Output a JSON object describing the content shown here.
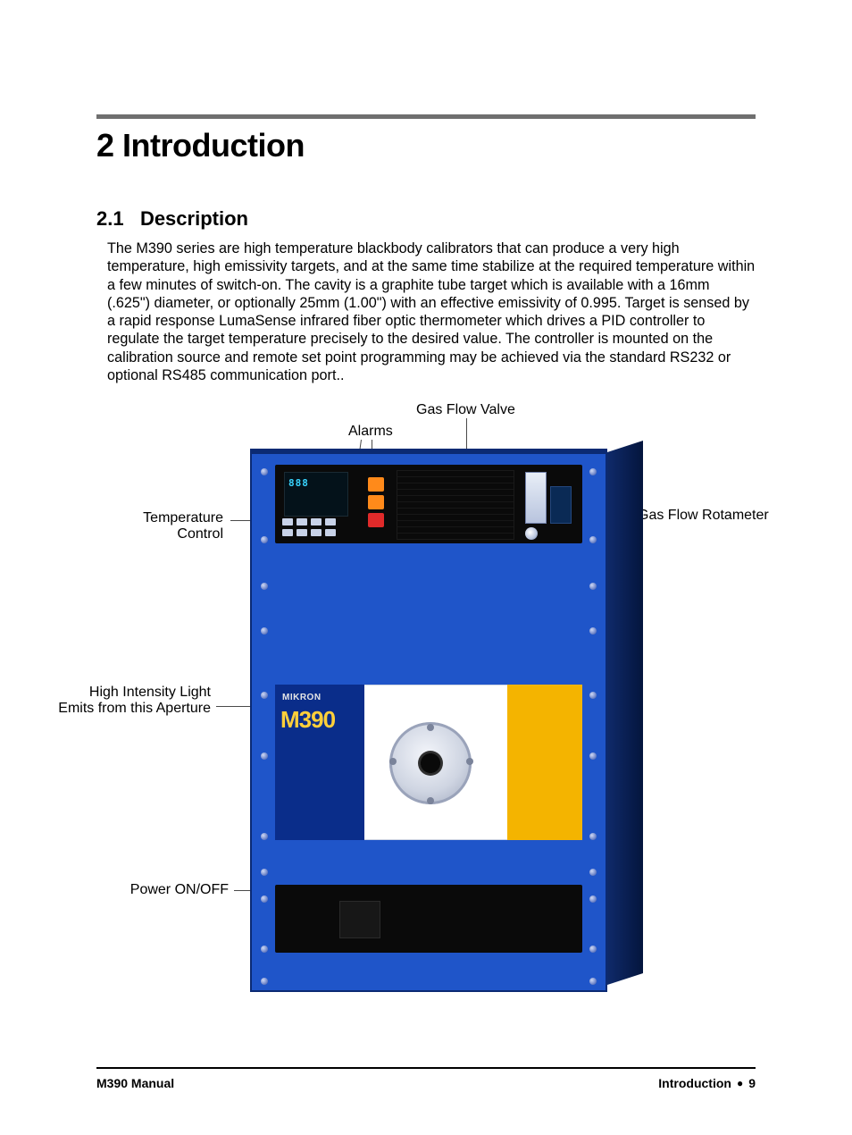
{
  "heading": "2 Introduction",
  "section": {
    "number": "2.1",
    "title": "Description",
    "body": "The M390 series are high temperature blackbody calibrators that can produce a very high temperature, high emissivity targets, and at the same time stabilize at the required temperature within a few minutes of switch-on. The cavity is a graphite tube target which is available with a 16mm (.625\") diameter, or optionally 25mm (1.00\") with an effective emissivity of 0.995. Target is sensed by a rapid response LumaSense infrared fiber optic thermometer which drives a PID controller to regulate the target temperature precisely to the desired value. The controller is mounted on the calibration source and remote set point programming may be achieved via the standard RS232 or optional RS485 communication port.."
  },
  "figure": {
    "callouts": {
      "gas_flow_valve": "Gas Flow Valve",
      "alarms": "Alarms",
      "temperature_control_line1": "Temperature",
      "temperature_control_line2": "Control",
      "gas_flow_rotameter": "Gas Flow Rotameter",
      "aperture_line1": "High Intensity Light",
      "aperture_line2": "Emits from this Aperture",
      "power": "Power ON/OFF"
    },
    "device": {
      "brand": "MIKRON",
      "model": "M390"
    }
  },
  "footer": {
    "left": "M390 Manual",
    "right_section": "Introduction",
    "right_page": "9"
  }
}
